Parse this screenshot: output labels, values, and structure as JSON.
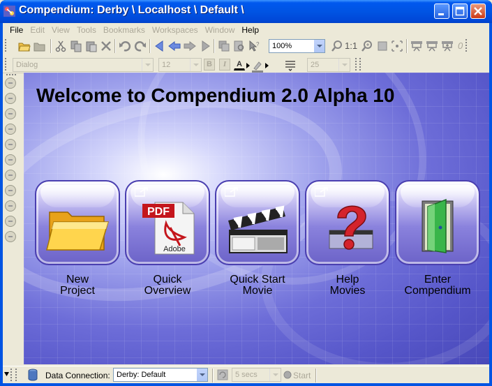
{
  "window": {
    "title": "Compendium: Derby \\ Localhost \\ Default \\",
    "controls": [
      "minimize",
      "maximize",
      "close"
    ]
  },
  "menubar": {
    "items": [
      {
        "label": "File",
        "enabled": true
      },
      {
        "label": "Edit",
        "enabled": false
      },
      {
        "label": "View",
        "enabled": false
      },
      {
        "label": "Tools",
        "enabled": false
      },
      {
        "label": "Bookmarks",
        "enabled": false
      },
      {
        "label": "Workspaces",
        "enabled": false
      },
      {
        "label": "Window",
        "enabled": false
      },
      {
        "label": "Help",
        "enabled": true
      }
    ]
  },
  "toolbar": {
    "zoom_value": "100%",
    "zoom_one_to_one": "1:1",
    "trailing_counter": "0"
  },
  "format_toolbar": {
    "font_family": "Dialog",
    "font_size": "12",
    "bold_label": "B",
    "italic_label": "I",
    "text_color_label": "A",
    "line_spacing": "25"
  },
  "canvas": {
    "welcome_title": "Welcome to Compendium 2.0 Alpha 10",
    "tiles": [
      {
        "label_line1": "New",
        "label_line2": "Project",
        "icon": "folder-icon"
      },
      {
        "label_line1": "Quick",
        "label_line2": "Overview",
        "icon": "pdf-document-icon",
        "art_text": "PDF",
        "art_subtext": "Adobe"
      },
      {
        "label_line1": "Quick Start",
        "label_line2": "Movie",
        "icon": "clapperboard-icon"
      },
      {
        "label_line1": "Help",
        "label_line2": "Movies",
        "icon": "help-question-icon"
      },
      {
        "label_line1": "Enter",
        "label_line2": "Compendium",
        "icon": "open-door-icon"
      }
    ]
  },
  "statusbar": {
    "data_connection_label": "Data Connection:",
    "data_connection_value": "Derby: Default",
    "interval_value": "5 secs",
    "start_label": "Start"
  },
  "colors": {
    "titlebar": "#0054e3",
    "chrome": "#ece9d8",
    "canvas_primary": "#6d6dd8",
    "tile_border": "#4a3fb0"
  }
}
